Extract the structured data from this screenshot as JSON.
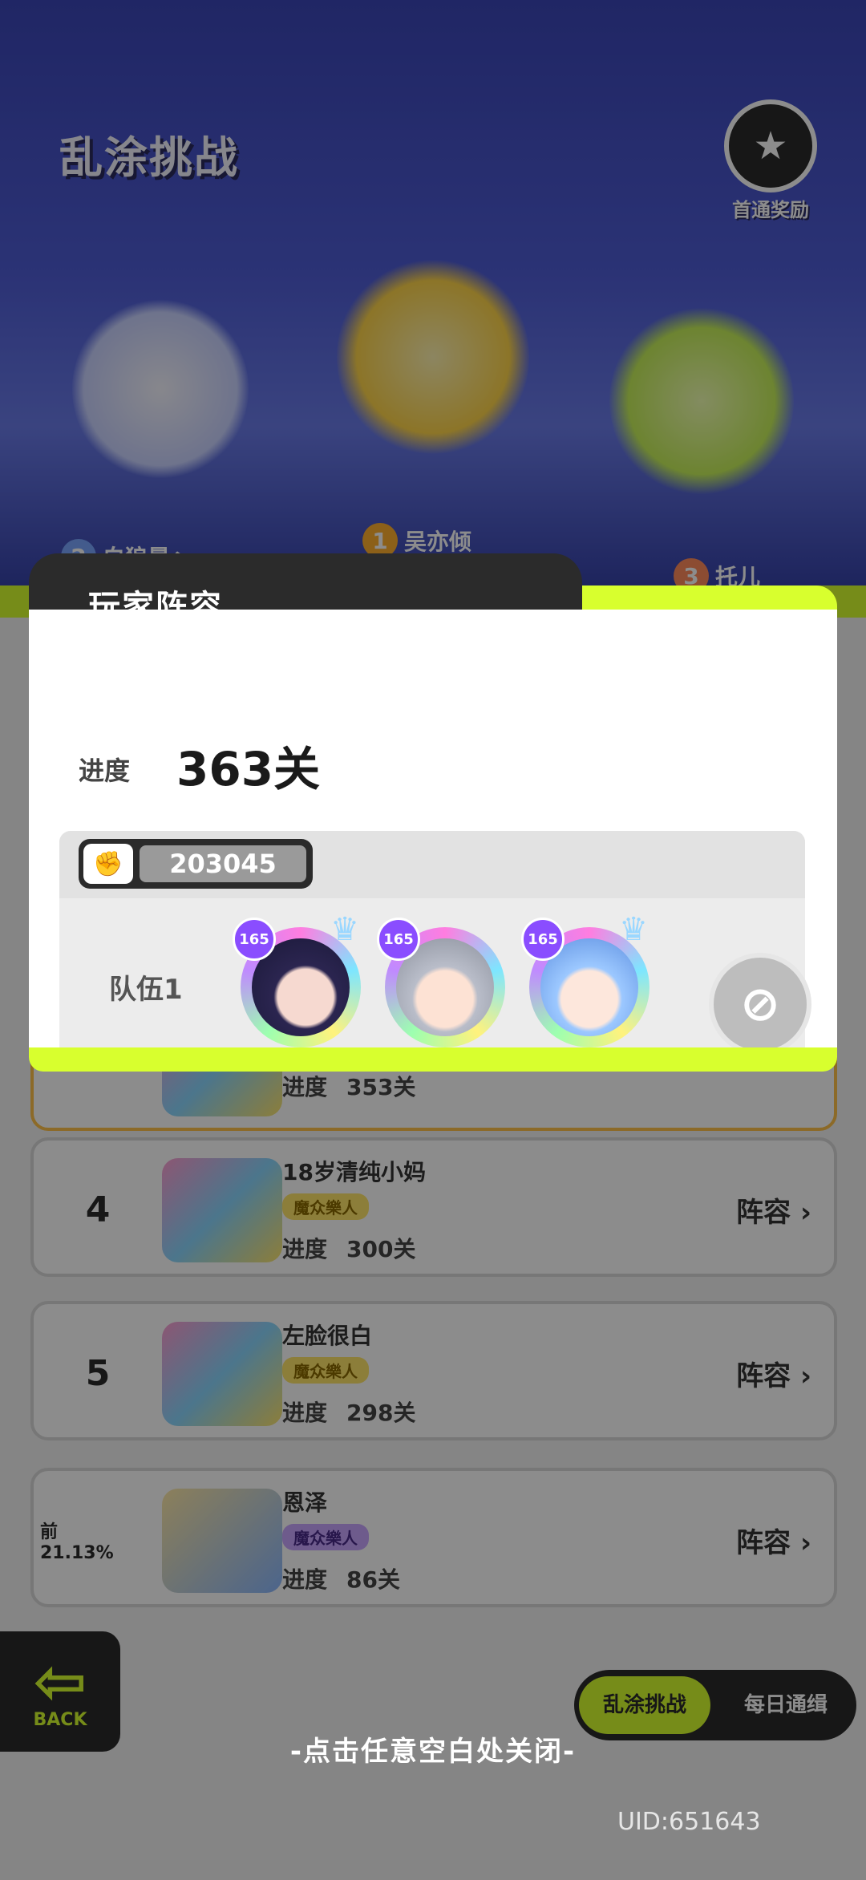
{
  "background": {
    "screen_title": "乱涂挑战",
    "first_clear_reward": "首通奖励",
    "podium": [
      {
        "rank": "2",
        "name": "白狼暴丶"
      },
      {
        "rank": "1",
        "name": "吴亦倾"
      },
      {
        "rank": "3",
        "name": "托儿"
      }
    ],
    "leaderboard": [
      {
        "rank": "",
        "name": "",
        "badge": "",
        "progress_label": "进度",
        "progress_value": "353关",
        "lineup_label": ""
      },
      {
        "rank": "4",
        "name": "18岁清纯小妈",
        "badge": "魔众樂人",
        "progress_label": "进度",
        "progress_value": "300关",
        "lineup_label": "阵容"
      },
      {
        "rank": "5",
        "name": "左脸很白",
        "badge": "魔众樂人",
        "progress_label": "进度",
        "progress_value": "298关",
        "lineup_label": "阵容"
      },
      {
        "rank": "前21.13%",
        "name": "恩泽",
        "badge": "魔众樂人",
        "progress_label": "进度",
        "progress_value": "86关",
        "lineup_label": "阵容"
      }
    ],
    "back_button": "BACK",
    "mode_tabs": [
      "乱涂挑战",
      "每日通缉"
    ]
  },
  "modal": {
    "title": "玩家阵容",
    "progress_label": "进度",
    "progress_value": "363关",
    "power_value": "203045",
    "team_label": "队伍1",
    "heroes": [
      {
        "level": "165",
        "icon": "hero-dark-hair"
      },
      {
        "level": "165",
        "icon": "hero-silver-hair"
      },
      {
        "level": "165",
        "icon": "hero-blue-hair"
      }
    ],
    "empty_slot_icon": "forbidden-icon"
  },
  "close_hint": "-点击任意空白处关闭-",
  "uid": "UID:651643",
  "colors": {
    "accent": "#d8ff2e",
    "dark": "#2b2b2b"
  }
}
